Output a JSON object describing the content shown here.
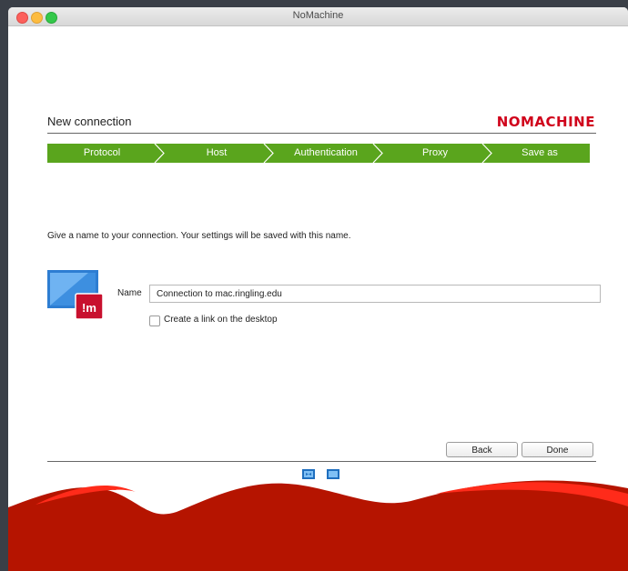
{
  "window": {
    "title": "NoMachine"
  },
  "header": {
    "title": "New connection",
    "brand": "NOMACHINE"
  },
  "steps": [
    "Protocol",
    "Host",
    "Authentication",
    "Proxy",
    "Save as"
  ],
  "description": "Give a name to your connection. Your settings will be saved with this name.",
  "form": {
    "name_label": "Name",
    "name_value": "Connection to mac.ringling.edu",
    "checkbox_label": "Create a link on the desktop",
    "checkbox_checked": false
  },
  "buttons": {
    "back": "Back",
    "done": "Done"
  },
  "icons": {
    "connection": "connection-monitor-icon",
    "nav": [
      "display-icon",
      "screen-icon"
    ]
  },
  "colors": {
    "step_bar": "#5aa51d",
    "brand": "#d0021b",
    "wave": "#b51400"
  }
}
